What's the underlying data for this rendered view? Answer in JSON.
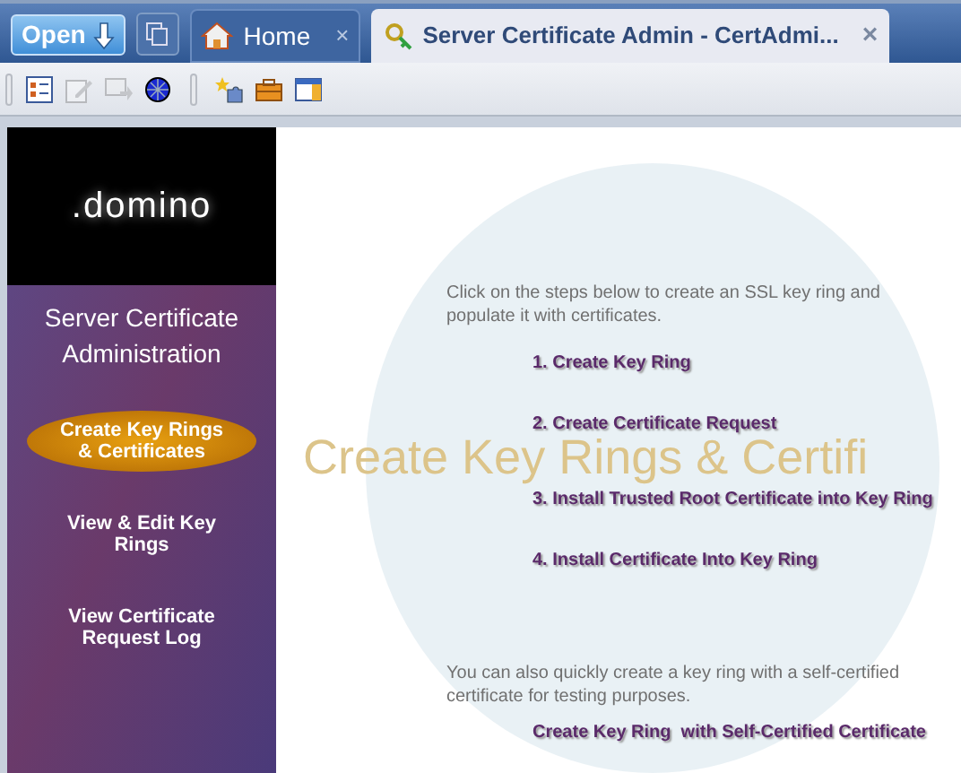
{
  "open_button": {
    "label": "Open"
  },
  "tabs": [
    {
      "label": "Home",
      "selected": false,
      "close": "×"
    },
    {
      "label": "Server Certificate Admin - CertAdmi...",
      "selected": true,
      "close": "×"
    }
  ],
  "toolbar": [
    {
      "kind": "form",
      "disabled": false
    },
    {
      "kind": "edit",
      "disabled": true
    },
    {
      "kind": "forward",
      "disabled": true
    },
    {
      "kind": "globe",
      "disabled": false
    },
    {
      "kind": "sep"
    },
    {
      "kind": "puzzle",
      "disabled": false
    },
    {
      "kind": "toolbox",
      "disabled": false
    },
    {
      "kind": "window",
      "disabled": false
    }
  ],
  "sidebar": {
    "logo": ".domino",
    "title": "Server Certificate Administration",
    "items": [
      {
        "label": "Create Key Rings & Certificates",
        "selected": true
      },
      {
        "label": "View & Edit Key Rings",
        "selected": false
      },
      {
        "label": "View Certificate Request Log",
        "selected": false
      }
    ]
  },
  "main": {
    "watermark": "Create Key Rings & Certifi",
    "intro": "Click on the steps below to create an SSL key ring and populate it with certificates.",
    "steps": [
      "1. Create Key Ring",
      "2. Create Certificate Request",
      "3. Install Trusted Root Certificate into Key Ring",
      "4. Install Certificate Into Key Ring"
    ],
    "note": "You can also quickly create a key ring with a self-certified certificate for testing purposes.",
    "link": "Create Key Ring  with Self-Certified Certificate"
  }
}
